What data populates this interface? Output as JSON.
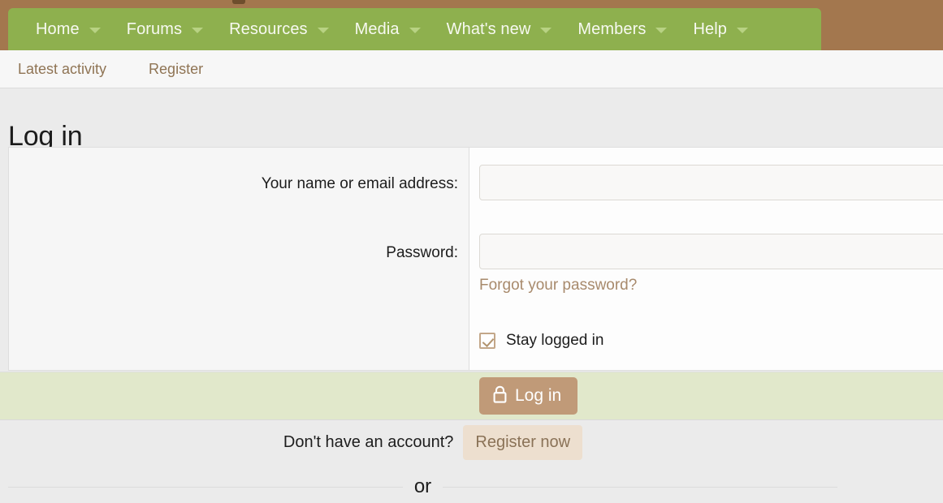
{
  "theme": {
    "banner_brown": "#a3774e",
    "nav_green": "#8eb04e",
    "nav_text": "#f7f9f1",
    "caret_green": "#b8d283",
    "link_brown": "#8f7454",
    "forgot_link_brown": "#a88a6c",
    "submit_bar_green": "#e1e8cb",
    "login_button_brown": "#c09a78",
    "register_button_tan": "#eddfcf",
    "page_background": "#ebebeb"
  },
  "primary_nav": {
    "items": [
      {
        "label": "Home",
        "has_caret": true
      },
      {
        "label": "Forums",
        "has_caret": true
      },
      {
        "label": "Resources",
        "has_caret": true
      },
      {
        "label": "Media",
        "has_caret": true
      },
      {
        "label": "What's new",
        "has_caret": true
      },
      {
        "label": "Members",
        "has_caret": true
      },
      {
        "label": "Help",
        "has_caret": true
      }
    ]
  },
  "secondary_nav": {
    "items": [
      {
        "label": "Latest activity"
      },
      {
        "label": "Register"
      }
    ]
  },
  "page": {
    "title": "Log in"
  },
  "form": {
    "name_label": "Your name or email address:",
    "name_value": "",
    "name_placeholder": "",
    "password_label": "Password:",
    "password_value": "",
    "password_placeholder": "",
    "forgot_link": "Forgot your password?",
    "stay_logged_in_label": "Stay logged in",
    "stay_logged_in_checked": true,
    "submit_label": "Log in",
    "submit_icon": "lock-icon"
  },
  "register": {
    "prompt": "Don't have an account?",
    "button_label": "Register now"
  },
  "divider": {
    "text": "or"
  }
}
